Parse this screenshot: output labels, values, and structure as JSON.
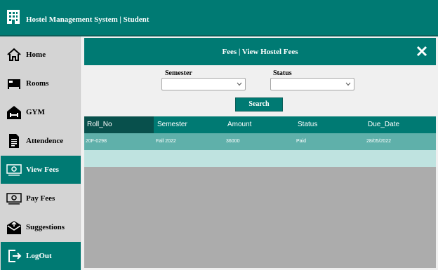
{
  "app": {
    "title": "Hostel Management System | Student"
  },
  "sidebar": {
    "items": [
      {
        "label": "Home",
        "icon": "home-icon"
      },
      {
        "label": "Rooms",
        "icon": "bed-icon"
      },
      {
        "label": "GYM",
        "icon": "gym-icon"
      },
      {
        "label": "Attendence",
        "icon": "document-icon"
      },
      {
        "label": "View Fees",
        "icon": "money-icon"
      },
      {
        "label": "Pay Fees",
        "icon": "money-icon"
      },
      {
        "label": "Suggestions",
        "icon": "mail-icon"
      },
      {
        "label": "LogOut",
        "icon": "logout-icon"
      }
    ],
    "active": "View Fees"
  },
  "panel": {
    "title": "Fees | View Hostel Fees",
    "semester_label": "Semester",
    "status_label": "Status",
    "semester_value": "",
    "status_value": "",
    "search_label": "Search"
  },
  "table": {
    "columns": [
      "Roll_No",
      "Semester",
      "Amount",
      "Status",
      "Due_Date"
    ],
    "rows": [
      [
        "20F-0298",
        "Fall 2022",
        "36000",
        "Paid",
        "28/05/2022"
      ]
    ]
  },
  "colors": {
    "accent": "#007a73",
    "sidebar_bg": "#d4d4d4",
    "row_selected": "#5fb0aa",
    "row_new": "#bfe3e0",
    "grid_bg": "#acacac"
  }
}
